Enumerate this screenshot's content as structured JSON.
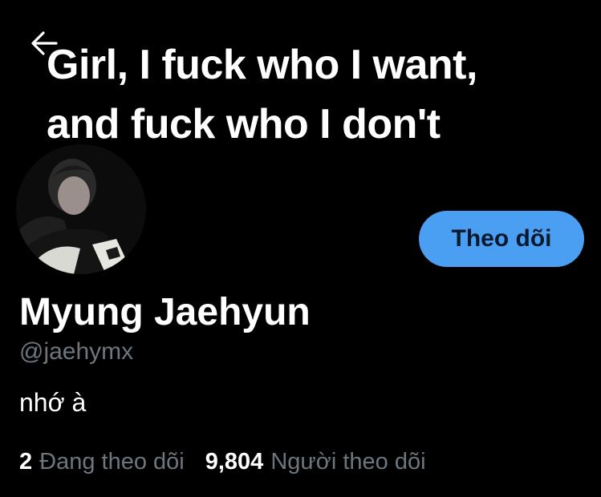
{
  "banner": {
    "line1": "Girl, I fuck who I want,",
    "line2": "and fuck who I don't"
  },
  "navigation": {
    "back_icon": "arrow-left-icon"
  },
  "profile": {
    "display_name": "Myung Jaehyun",
    "handle": "@jaehymx",
    "bio": "nhớ à",
    "follow_button": "Theo dõi"
  },
  "stats": {
    "following_count": "2",
    "following_label": "Đang theo dõi",
    "followers_count": "9,804",
    "followers_label": "Người theo dõi"
  },
  "colors": {
    "background": "#000000",
    "follow_button": "#4b9ff2",
    "muted_text": "#6e767d",
    "primary_text": "#ffffff"
  }
}
